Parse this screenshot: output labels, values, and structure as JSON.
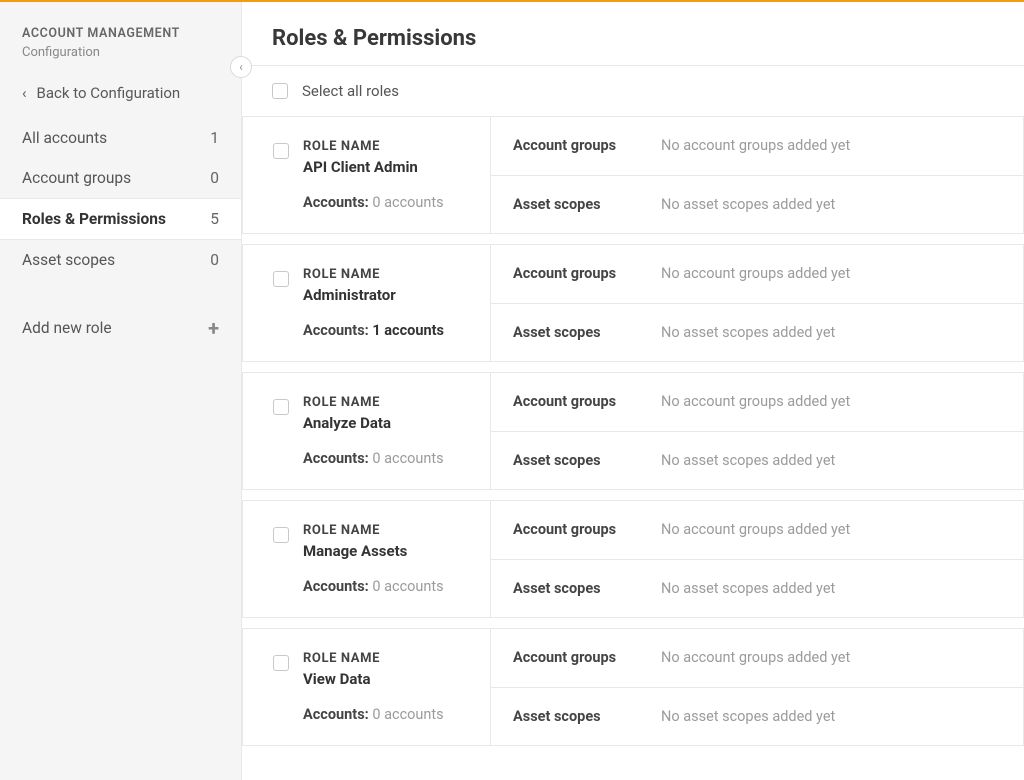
{
  "sidebar": {
    "title": "ACCOUNT MANAGEMENT",
    "subtitle": "Configuration",
    "back_label": "Back to Configuration",
    "items": [
      {
        "label": "All accounts",
        "count": "1"
      },
      {
        "label": "Account groups",
        "count": "0"
      },
      {
        "label": "Roles & Permissions",
        "count": "5"
      },
      {
        "label": "Asset scopes",
        "count": "0"
      }
    ],
    "add_role_label": "Add new role"
  },
  "main": {
    "page_title": "Roles & Permissions",
    "select_all_label": "Select all roles",
    "labels": {
      "role_name_header": "ROLE NAME",
      "accounts_label": "Accounts:",
      "account_groups_label": "Account groups",
      "asset_scopes_label": "Asset scopes"
    },
    "messages": {
      "no_account_groups": "No account groups added yet",
      "no_asset_scopes": "No asset scopes added yet"
    },
    "roles": [
      {
        "name": "API Client Admin",
        "accounts_count": 0,
        "accounts_text": "0 accounts",
        "accounts_emphasis": false
      },
      {
        "name": "Administrator",
        "accounts_count": 1,
        "accounts_text": "1 accounts",
        "accounts_emphasis": true
      },
      {
        "name": "Analyze Data",
        "accounts_count": 0,
        "accounts_text": "0 accounts",
        "accounts_emphasis": false
      },
      {
        "name": "Manage Assets",
        "accounts_count": 0,
        "accounts_text": "0 accounts",
        "accounts_emphasis": false
      },
      {
        "name": "View Data",
        "accounts_count": 0,
        "accounts_text": "0 accounts",
        "accounts_emphasis": false
      }
    ]
  }
}
